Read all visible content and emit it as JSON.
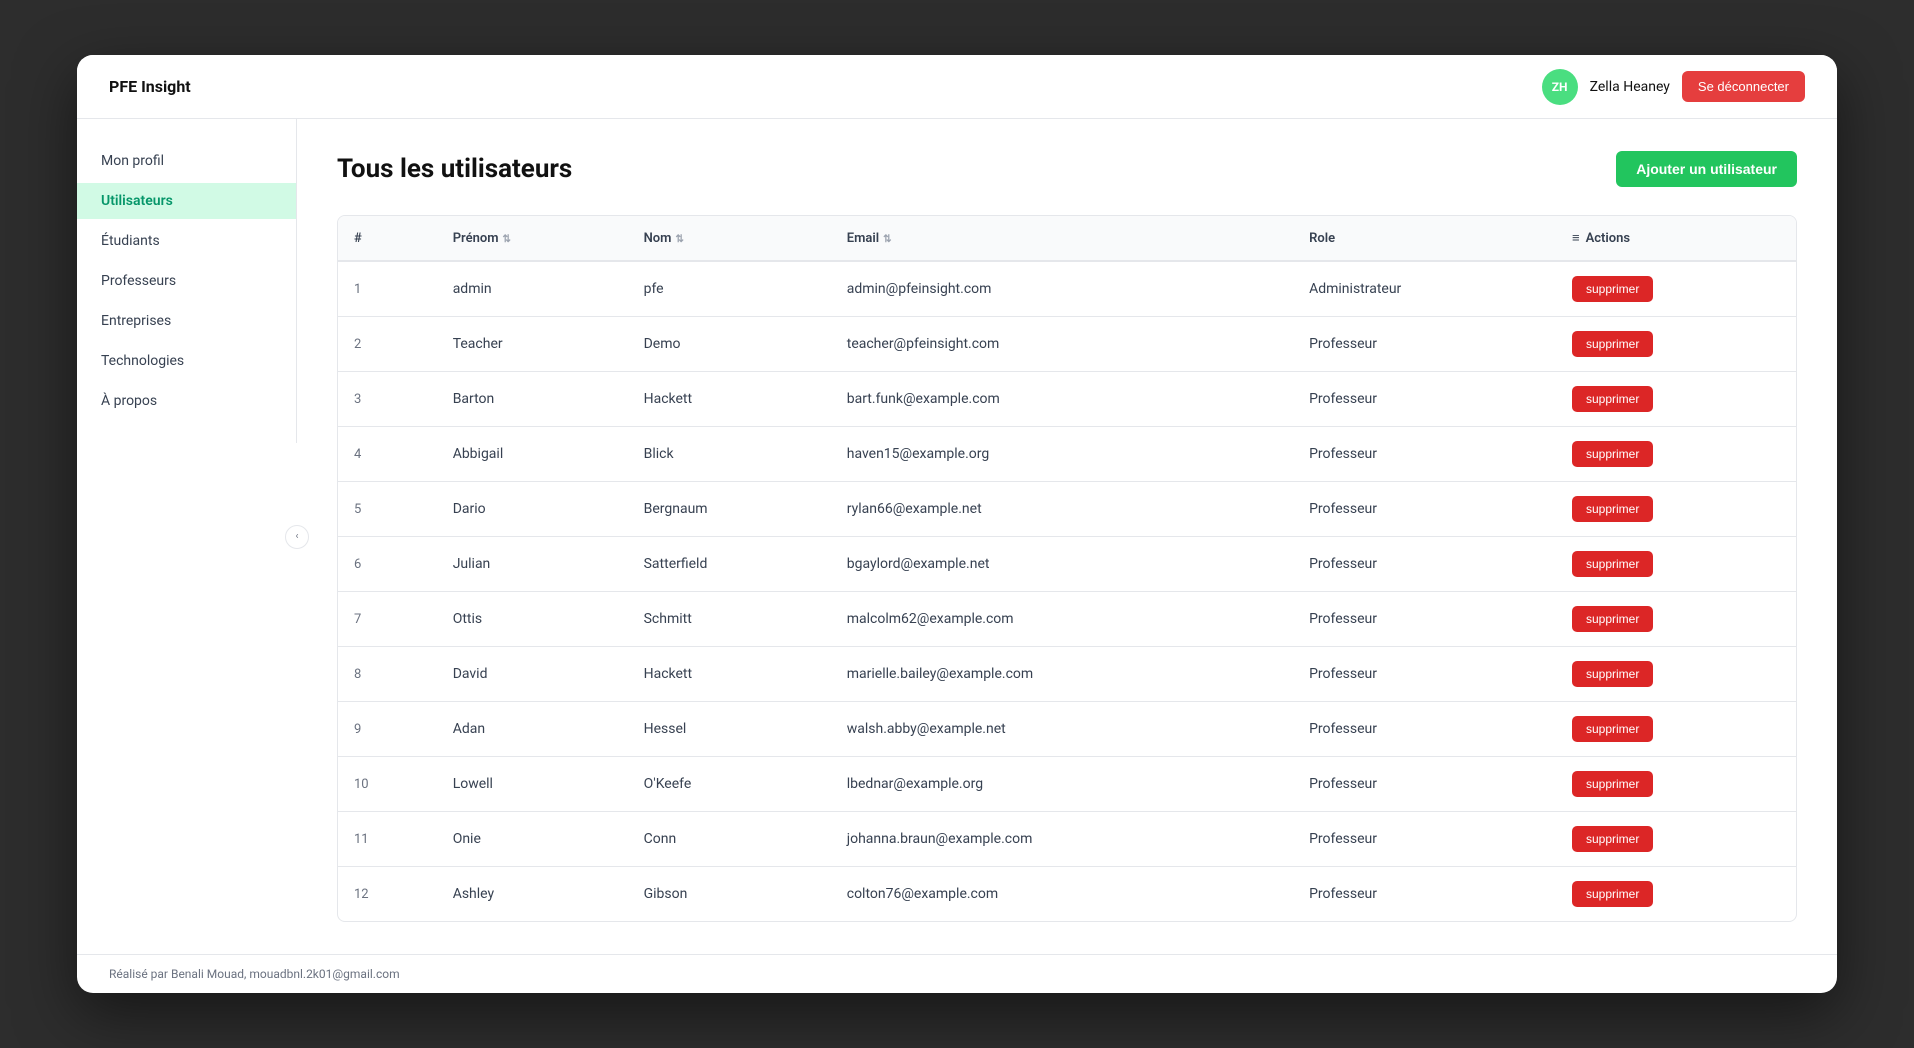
{
  "app": {
    "title": "PFE Insight",
    "logo_text": "PFE Insight"
  },
  "header": {
    "user_initials": "ZH",
    "user_name": "Zella Heaney",
    "logout_label": "Se déconnecter"
  },
  "sidebar": {
    "items": [
      {
        "id": "mon-profil",
        "label": "Mon profil",
        "active": false
      },
      {
        "id": "utilisateurs",
        "label": "Utilisateurs",
        "active": true
      },
      {
        "id": "etudiants",
        "label": "Étudiants",
        "active": false
      },
      {
        "id": "professeurs",
        "label": "Professeurs",
        "active": false
      },
      {
        "id": "entreprises",
        "label": "Entreprises",
        "active": false
      },
      {
        "id": "technologies",
        "label": "Technologies",
        "active": false
      },
      {
        "id": "a-propos",
        "label": "À propos",
        "active": false
      }
    ],
    "collapse_icon": "‹"
  },
  "main": {
    "page_title": "Tous les utilisateurs",
    "add_user_label": "Ajouter un utilisateur",
    "table": {
      "columns": [
        {
          "id": "num",
          "label": "#",
          "sortable": false
        },
        {
          "id": "prenom",
          "label": "Prénom",
          "sortable": true
        },
        {
          "id": "nom",
          "label": "Nom",
          "sortable": true
        },
        {
          "id": "email",
          "label": "Email",
          "sortable": true
        },
        {
          "id": "role",
          "label": "Role",
          "sortable": false
        },
        {
          "id": "actions",
          "label": "Actions",
          "sortable": false
        }
      ],
      "rows": [
        {
          "num": 1,
          "prenom": "admin",
          "nom": "pfe",
          "email": "admin@pfeinsight.com",
          "role": "Administrateur"
        },
        {
          "num": 2,
          "prenom": "Teacher",
          "nom": "Demo",
          "email": "teacher@pfeinsight.com",
          "role": "Professeur"
        },
        {
          "num": 3,
          "prenom": "Barton",
          "nom": "Hackett",
          "email": "bart.funk@example.com",
          "role": "Professeur"
        },
        {
          "num": 4,
          "prenom": "Abbigail",
          "nom": "Blick",
          "email": "haven15@example.org",
          "role": "Professeur"
        },
        {
          "num": 5,
          "prenom": "Dario",
          "nom": "Bergnaum",
          "email": "rylan66@example.net",
          "role": "Professeur"
        },
        {
          "num": 6,
          "prenom": "Julian",
          "nom": "Satterfield",
          "email": "bgaylord@example.net",
          "role": "Professeur"
        },
        {
          "num": 7,
          "prenom": "Ottis",
          "nom": "Schmitt",
          "email": "malcolm62@example.com",
          "role": "Professeur"
        },
        {
          "num": 8,
          "prenom": "David",
          "nom": "Hackett",
          "email": "marielle.bailey@example.com",
          "role": "Professeur"
        },
        {
          "num": 9,
          "prenom": "Adan",
          "nom": "Hessel",
          "email": "walsh.abby@example.net",
          "role": "Professeur"
        },
        {
          "num": 10,
          "prenom": "Lowell",
          "nom": "O'Keefe",
          "email": "lbednar@example.org",
          "role": "Professeur"
        },
        {
          "num": 11,
          "prenom": "Onie",
          "nom": "Conn",
          "email": "johanna.braun@example.com",
          "role": "Professeur"
        },
        {
          "num": 12,
          "prenom": "Ashley",
          "nom": "Gibson",
          "email": "colton76@example.com",
          "role": "Professeur"
        }
      ],
      "delete_label": "supprimer"
    }
  },
  "footer": {
    "text": "Réalisé par Benali Mouad, mouadbnl.2k01@gmail.com"
  }
}
